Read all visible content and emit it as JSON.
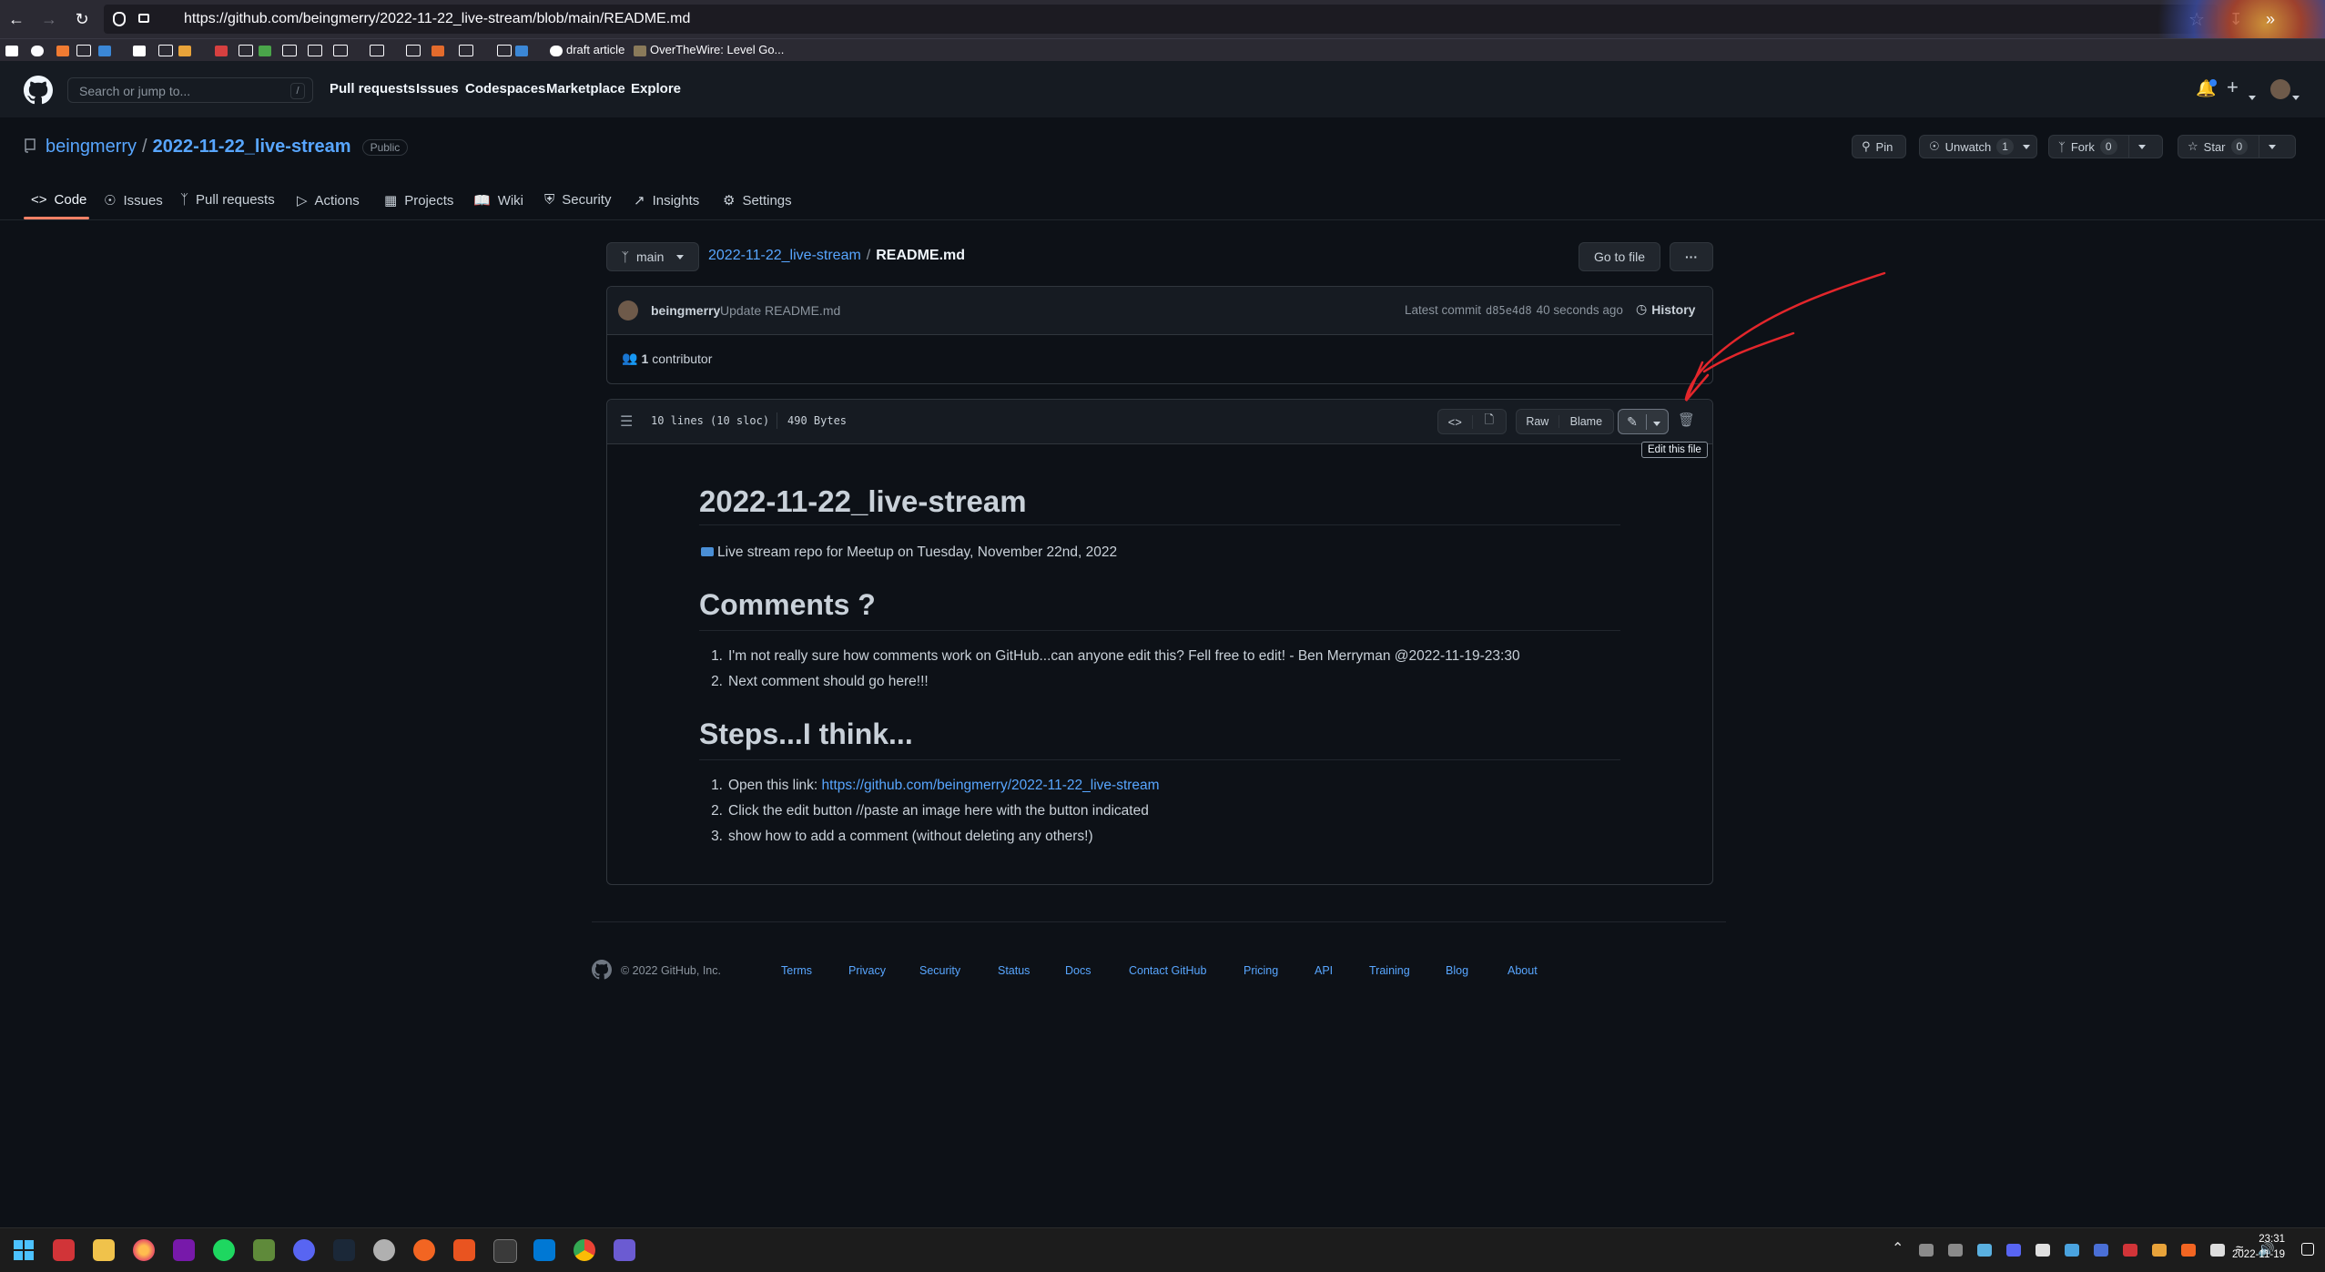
{
  "browser": {
    "url": "https://github.com/beingmerry/2022-11-22_live-stream/blob/main/README.md",
    "bookmarks": [
      "draft article",
      "OverTheWire: Level Go..."
    ]
  },
  "header": {
    "search_placeholder": "Search or jump to...",
    "search_shortcut": "/",
    "nav": [
      "Pull requests",
      "Issues",
      "Codespaces",
      "Marketplace",
      "Explore"
    ]
  },
  "repo": {
    "owner": "beingmerry",
    "separator": "/",
    "name": "2022-11-22_live-stream",
    "visibility": "Public",
    "actions": {
      "pin": "Pin",
      "unwatch": "Unwatch",
      "watch_count": "1",
      "fork": "Fork",
      "fork_count": "0",
      "star": "Star",
      "star_count": "0"
    },
    "tabs": [
      "Code",
      "Issues",
      "Pull requests",
      "Actions",
      "Projects",
      "Wiki",
      "Security",
      "Insights",
      "Settings"
    ]
  },
  "file_nav": {
    "branch": "main",
    "path_repo": "2022-11-22_live-stream",
    "path_sep": "/",
    "path_file": "README.md",
    "go_to_file": "Go to file",
    "more": "···"
  },
  "commit": {
    "author": "beingmerry",
    "message": "Update README.md",
    "latest_label": "Latest commit",
    "sha": "d85e4d8",
    "time": "40 seconds ago",
    "history": "History",
    "contributors_count": "1",
    "contributors_label": "contributor"
  },
  "file_header": {
    "lines": "10 lines (10 sloc)",
    "size": "490 Bytes",
    "raw": "Raw",
    "blame": "Blame",
    "tooltip": "Edit this file"
  },
  "readme": {
    "title": "2022-11-22_live-stream",
    "intro": "Live stream repo for Meetup on Tuesday, November 22nd, 2022",
    "comments_heading": "Comments ?",
    "comments": [
      "I'm not really sure how comments work on GitHub...can anyone edit this? Fell free to edit! - Ben Merryman @2022-11-19-23:30",
      "Next comment should go here!!!"
    ],
    "steps_heading": "Steps...I think...",
    "steps_1_prefix": "Open this link: ",
    "steps_1_link": "https://github.com/beingmerry/2022-11-22_live-stream",
    "steps_2": "Click the edit button //paste an image here with the button indicated",
    "steps_3": "show how to add a comment (without deleting any others!)"
  },
  "footer": {
    "copyright": "© 2022 GitHub, Inc.",
    "links": [
      "Terms",
      "Privacy",
      "Security",
      "Status",
      "Docs",
      "Contact GitHub",
      "Pricing",
      "API",
      "Training",
      "Blog",
      "About"
    ]
  },
  "taskbar": {
    "time": "23:31",
    "date": "2022-11-19"
  },
  "colors": {
    "bg": "#0d1117",
    "header": "#161b22",
    "link": "#58a6ff",
    "annotation": "#e3262b",
    "tab_underline": "#f78166"
  }
}
